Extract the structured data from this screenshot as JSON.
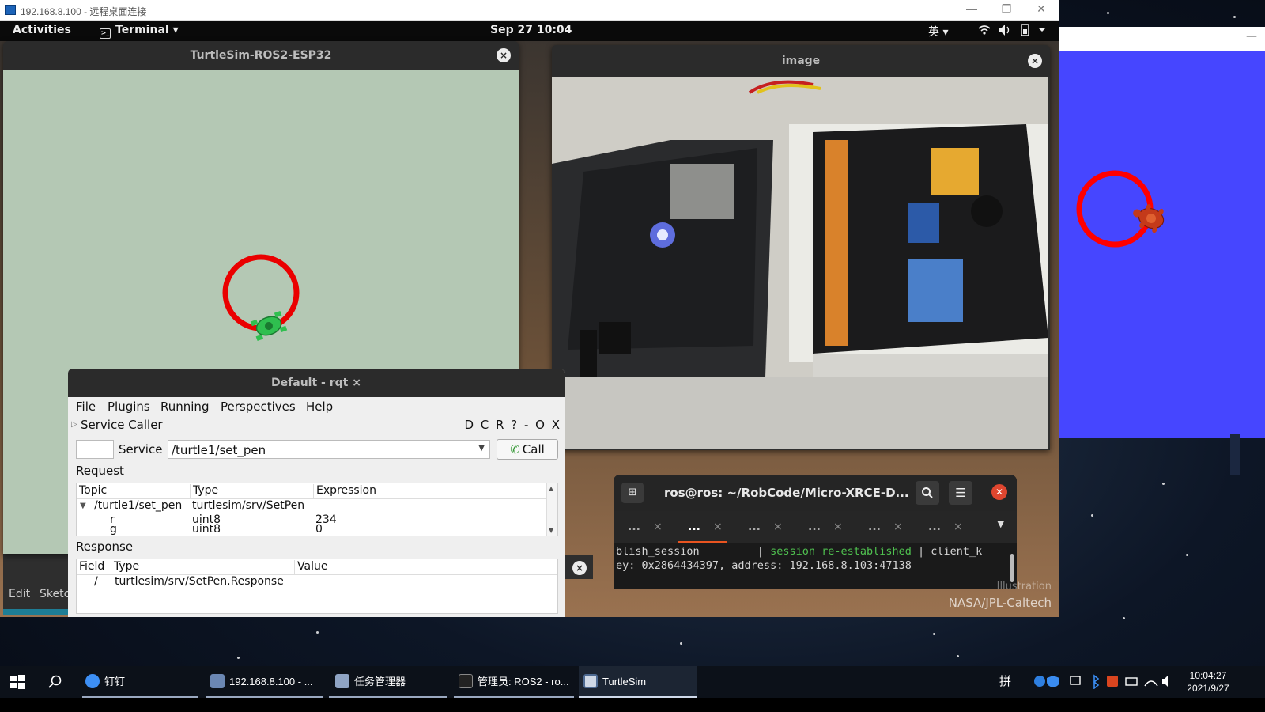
{
  "rdp_window": {
    "title": "192.168.8.100 - 远程桌面连接",
    "minimize": "—",
    "restore": "❐",
    "close": "✕"
  },
  "gnome_bar": {
    "activities": "Activities",
    "app_name": "Terminal",
    "app_arrow": "▾",
    "clock": "Sep 27  10:04",
    "input_method": "英 ▾",
    "tray_icons": "▾ ◀) ▯ ▾"
  },
  "turtlesim_window": {
    "title": "TurtleSim-ROS2-ESP32",
    "close": "×",
    "pen_color": "#ea0000",
    "background_color": "#b4c8b4"
  },
  "sketch_window": {
    "edit": "Edit",
    "sketch": "Sketc"
  },
  "image_window": {
    "title": "image",
    "close": "×"
  },
  "rqt_window": {
    "title": "Default - rqt",
    "close": "×",
    "menu": [
      "File",
      "Plugins",
      "Running",
      "Perspectives",
      "Help"
    ],
    "plugin_name": "Service Caller",
    "plugin_controls": "D C R ?  - O X",
    "service_label": "Service",
    "service_value": "/turtle1/set_pen",
    "call_label": "Call",
    "request_label": "Request",
    "request_columns": [
      "Topic",
      "Type",
      "Expression"
    ],
    "request_rows": [
      {
        "topic": "/turtle1/set_pen",
        "type": "turtlesim/srv/SetPen",
        "expression": ""
      },
      {
        "topic": "r",
        "type": "uint8",
        "expression": "234"
      },
      {
        "topic": "g",
        "type": "uint8",
        "expression": "0"
      }
    ],
    "response_label": "Response",
    "response_columns": [
      "Field",
      "Type",
      "Value"
    ],
    "response_rows": [
      {
        "field": "/",
        "type": "turtlesim/srv/SetPen.Response",
        "value": ""
      }
    ]
  },
  "terminal": {
    "title": "ros@ros: ~/RobCode/Micro-XRCE-D...",
    "tabs": [
      {
        "label": "...",
        "active": false
      },
      {
        "label": "...",
        "active": true
      },
      {
        "label": "...",
        "active": false
      },
      {
        "label": "...",
        "active": false
      },
      {
        "label": "...",
        "active": false
      },
      {
        "label": "...",
        "active": false
      }
    ],
    "tab_close": "×",
    "line1_a": "blish_session         | ",
    "line1_b": "session re-established",
    "line1_c": " | client_k",
    "line2": "ey: 0x2864434397, address: 192.168.8.103:47138"
  },
  "credits": {
    "line1": "Illustration",
    "line2": "NASA/JPL-Caltech"
  },
  "local_turtlesim": {
    "minimize": "—",
    "background_color": "#4646ff",
    "pen_color": "#ff0000"
  },
  "taskbar": {
    "items": [
      {
        "label": "钉钉",
        "icon": "dingtalk-icon"
      },
      {
        "label": "192.168.8.100 - ...",
        "icon": "remote-desktop-icon"
      },
      {
        "label": "任务管理器",
        "icon": "task-manager-icon"
      },
      {
        "label": "管理员: ROS2 - ro...",
        "icon": "cmd-icon"
      },
      {
        "label": "TurtleSim",
        "icon": "turtlesim-icon"
      }
    ],
    "ime": "拼",
    "time": "10:04:27",
    "date": "2021/9/27"
  }
}
